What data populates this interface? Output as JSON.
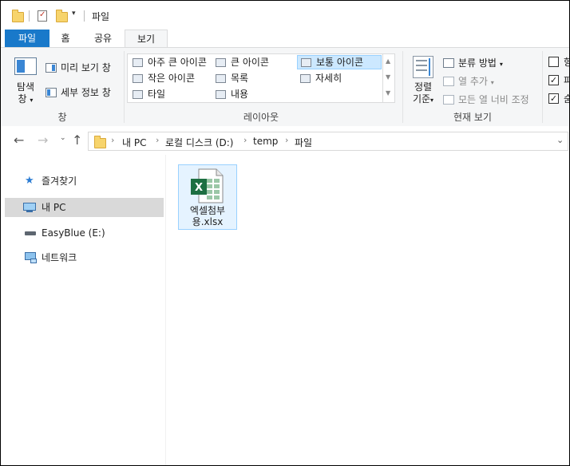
{
  "titlebar": {
    "title": "파일"
  },
  "tabs": [
    {
      "label": "파일"
    },
    {
      "label": "홈"
    },
    {
      "label": "공유"
    },
    {
      "label": "보기"
    }
  ],
  "ribbon": {
    "pane": {
      "nav_pane_line1": "탐색",
      "nav_pane_line2": "창",
      "preview_pane": "미리 보기 창",
      "details_pane": "세부 정보 창",
      "group_label": "창"
    },
    "layout": {
      "items": [
        "아주 큰 아이콘",
        "큰 아이콘",
        "보통 아이콘",
        "작은 아이콘",
        "목록",
        "자세히",
        "타일",
        "내용"
      ],
      "selected": "보통 아이콘",
      "group_label": "레이아웃"
    },
    "current_view": {
      "sort_line1": "정렬",
      "sort_line2": "기준",
      "group_by": "분류 방법",
      "add_columns": "열 추가",
      "size_columns": "모든 열 너비 조정",
      "group_label": "현재 보기"
    },
    "show_hide": {
      "checkbox_labels": [
        "항",
        "파",
        "숨"
      ],
      "checked": [
        false,
        true,
        true
      ]
    }
  },
  "address": {
    "crumbs": [
      "내 PC",
      "로컬 디스크 (D:)",
      "temp",
      "파일"
    ]
  },
  "nav": {
    "items": [
      "즐겨찾기",
      "내 PC",
      "EasyBlue (E:)",
      "네트워크"
    ],
    "selected": "내 PC"
  },
  "files": [
    {
      "name": "엑셀첨부용.xlsx",
      "icon": "excel-file-icon"
    }
  ],
  "colors": {
    "file_tab": "#1979ca",
    "selection": "#cce8ff",
    "excel_green": "#1d6f42"
  }
}
